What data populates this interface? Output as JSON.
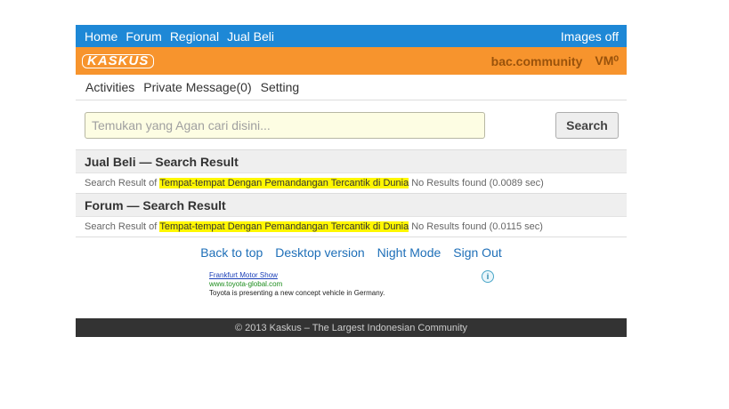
{
  "topnav": {
    "links": [
      "Home",
      "Forum",
      "Regional",
      "Jual Beli"
    ],
    "images_toggle": "Images off"
  },
  "brandbar": {
    "logo_text": "KASKUS",
    "community": "bac.community",
    "vm": "VM⁰"
  },
  "usernav": {
    "items": [
      "Activities",
      "Private Message(0)",
      "Setting"
    ]
  },
  "search": {
    "placeholder": "Temukan yang Agan cari disini...",
    "button_label": "Search"
  },
  "results": [
    {
      "heading": "Jual Beli — Search Result",
      "prefix": "Search Result of",
      "query": "Tempat-tempat Dengan Pemandangan Tercantik di Dunia",
      "status": "No Results found (0.0089 sec)"
    },
    {
      "heading": "Forum — Search Result",
      "prefix": "Search Result of",
      "query": "Tempat-tempat Dengan Pemandangan Tercantik di Dunia",
      "status": "No Results found (0.0115 sec)"
    }
  ],
  "footer_links": [
    "Back to top",
    "Desktop version",
    "Night Mode",
    "Sign Out"
  ],
  "ad": {
    "title": "Frankfurt Motor Show",
    "url": "www.toyota-global.com",
    "description": "Toyota is presenting a new concept vehicle in Germany.",
    "info_glyph": "i"
  },
  "copyright": "© 2013 Kaskus – The Largest Indonesian Community",
  "colors": {
    "topnav_bg": "#1e88d6",
    "brandbar_bg": "#f7942d",
    "highlight": "#fff700",
    "footer_bg": "#333333"
  }
}
